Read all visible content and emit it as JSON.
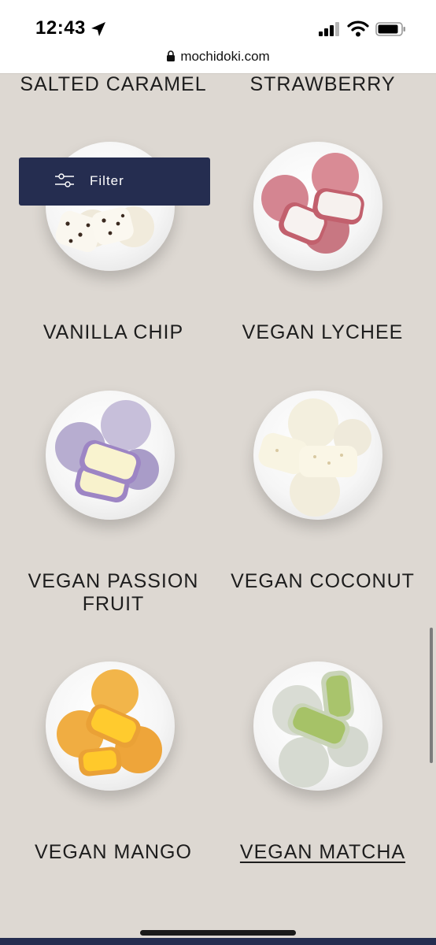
{
  "status_bar": {
    "time": "12:43",
    "icons": [
      "location-arrow-icon",
      "cellular-signal-icon",
      "wifi-icon",
      "battery-icon"
    ]
  },
  "browser": {
    "url": "mochidoki.com",
    "icons": [
      "lock-icon"
    ]
  },
  "filter": {
    "label": "Filter",
    "icon": "sliders-icon",
    "background": "#252d50"
  },
  "products": [
    {
      "name": "SALTED CARAMEL"
    },
    {
      "name": "STRAWBERRY"
    },
    {
      "name": "VANILLA CHIP"
    },
    {
      "name": "VEGAN LYCHEE"
    },
    {
      "name": "VEGAN PASSION FRUIT",
      "line1": "VEGAN PASSION",
      "line2": "FRUIT"
    },
    {
      "name": "VEGAN COCONUT"
    },
    {
      "name": "VEGAN MANGO"
    },
    {
      "name": "VEGAN MATCHA"
    }
  ],
  "colors": {
    "page_background": "#ddd8d2",
    "accent": "#252d50",
    "text": "#1d1d1d"
  }
}
